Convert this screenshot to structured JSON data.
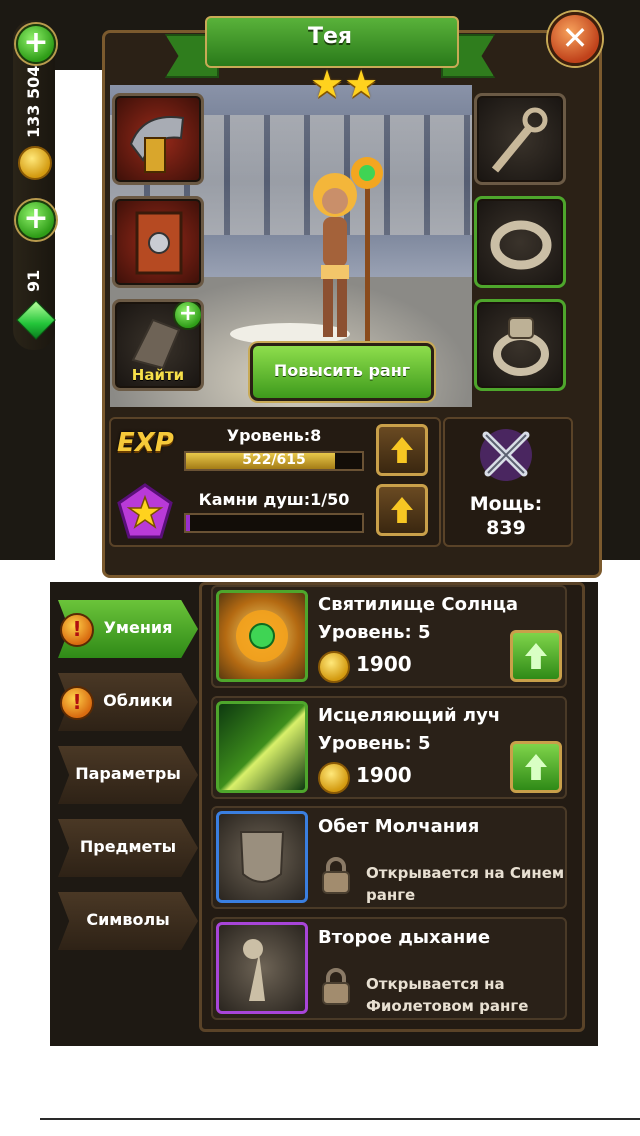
{
  "currency": {
    "gold": "133 504",
    "gems": "91"
  },
  "hero": {
    "name": "Тея",
    "stars": 2,
    "find_label": "Найти",
    "rank_button": "Повысить ранг",
    "level_label": "Уровень:8",
    "exp_text": "522/615",
    "exp_progress": 0.849,
    "exp_badge": "EXP",
    "soul_label": "Камни душ:1/50",
    "soul_progress": 0.02,
    "power_label": "Мощь:",
    "power_value": "839"
  },
  "tabs": [
    {
      "label": "Умения",
      "active": true,
      "alert": true
    },
    {
      "label": "Облики",
      "active": false,
      "alert": true
    },
    {
      "label": "Параметры",
      "active": false,
      "alert": false
    },
    {
      "label": "Предметы",
      "active": false,
      "alert": false
    },
    {
      "label": "Символы",
      "active": false,
      "alert": false
    }
  ],
  "skills": [
    {
      "name": "Святилище Солнца",
      "level": "Уровень: 5",
      "cost": "1900",
      "border": "green"
    },
    {
      "name": "Исцеляющий луч",
      "level": "Уровень: 5",
      "cost": "1900",
      "border": "green"
    },
    {
      "name": "Обет Молчания",
      "locked_text_1": "Открывается на Синем",
      "locked_text_2": "ранге",
      "border": "blue"
    },
    {
      "name": "Второе дыхание",
      "locked_text_1": "Открывается на",
      "locked_text_2": "Фиолетовом ранге",
      "border": "purple"
    }
  ],
  "icons": {
    "close": "close-icon",
    "plus": "plus-icon",
    "coin": "gold-coin-icon",
    "gem": "green-gem-icon",
    "star": "star-icon",
    "up": "upgrade-arrow-icon",
    "lock": "padlock-icon",
    "swords": "crossed-swords-icon"
  },
  "colors": {
    "accent_green": "#3e9a1c",
    "gold": "#f7c623",
    "frame_brown": "#5a4328",
    "exp_fill": "#d5b23a",
    "soul_fill": "#9a2fd0"
  }
}
